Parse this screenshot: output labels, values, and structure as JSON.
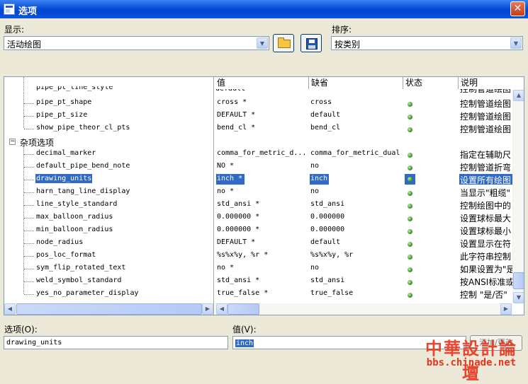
{
  "window": {
    "title": "选项"
  },
  "display": {
    "label": "显示:",
    "value": "活动绘图"
  },
  "sort": {
    "label": "排序:",
    "value": "按类别"
  },
  "columns": {
    "value": "值",
    "default": "缺省",
    "status": "状态",
    "desc": "说明"
  },
  "tree": {
    "partial_top": "pipe_pt_line_style",
    "items": [
      {
        "name": "pipe_pt_shape",
        "value": "cross *",
        "default": "cross",
        "desc": "控制管道绘图"
      },
      {
        "name": "pipe_pt_size",
        "value": "DEFAULT *",
        "default": "default",
        "desc": "控制管道绘图"
      },
      {
        "name": "show_pipe_theor_cl_pts",
        "value": "bend_cl *",
        "default": "bend_cl",
        "desc": "控制管道绘图"
      }
    ],
    "group": {
      "label": "杂项选项"
    },
    "group_items": [
      {
        "name": "decimal_marker",
        "value": "comma_for_metric_d...",
        "default": "comma_for_metric_dual",
        "desc": "指定在辅助尺"
      },
      {
        "name": "default_pipe_bend_note",
        "value": "NO *",
        "default": "no",
        "desc": "控制管道折弯"
      },
      {
        "name": "drawing_units",
        "value": "inch *",
        "default": "inch",
        "desc": "设置所有绘图"
      },
      {
        "name": "harn_tang_line_display",
        "value": "no *",
        "default": "no",
        "desc": "当显示\"粗缆\""
      },
      {
        "name": "line_style_standard",
        "value": "std_ansi *",
        "default": "std_ansi",
        "desc": "控制绘图中的"
      },
      {
        "name": "max_balloon_radius",
        "value": "0.000000 *",
        "default": "0.000000",
        "desc": "设置球标最大"
      },
      {
        "name": "min_balloon_radius",
        "value": "0.000000 *",
        "default": "0.000000",
        "desc": "设置球标最小"
      },
      {
        "name": "node_radius",
        "value": "DEFAULT *",
        "default": "default",
        "desc": "设置显示在符"
      },
      {
        "name": "pos_loc_format",
        "value": "%s%x%y, %r *",
        "default": "%s%x%y, %r",
        "desc": "此字符串控制"
      },
      {
        "name": "sym_flip_rotated_text",
        "value": "no *",
        "default": "no",
        "desc": "如果设置为\"是"
      },
      {
        "name": "weld_symbol_standard",
        "value": "std_ansi *",
        "default": "std_ansi",
        "desc": "按ANSI标准或"
      },
      {
        "name": "yes_no_parameter_display",
        "value": "true_false *",
        "default": "true_false",
        "desc": "控制 \"是/否\""
      }
    ]
  },
  "option_field": {
    "label": "选项(O):",
    "value": "drawing_units"
  },
  "value_field": {
    "label": "值(V):",
    "value": "inch"
  },
  "apply_button": {
    "label": "添加/更改"
  },
  "watermark": {
    "title": "中華設計論壇",
    "url": "bbs.chinade.net"
  }
}
